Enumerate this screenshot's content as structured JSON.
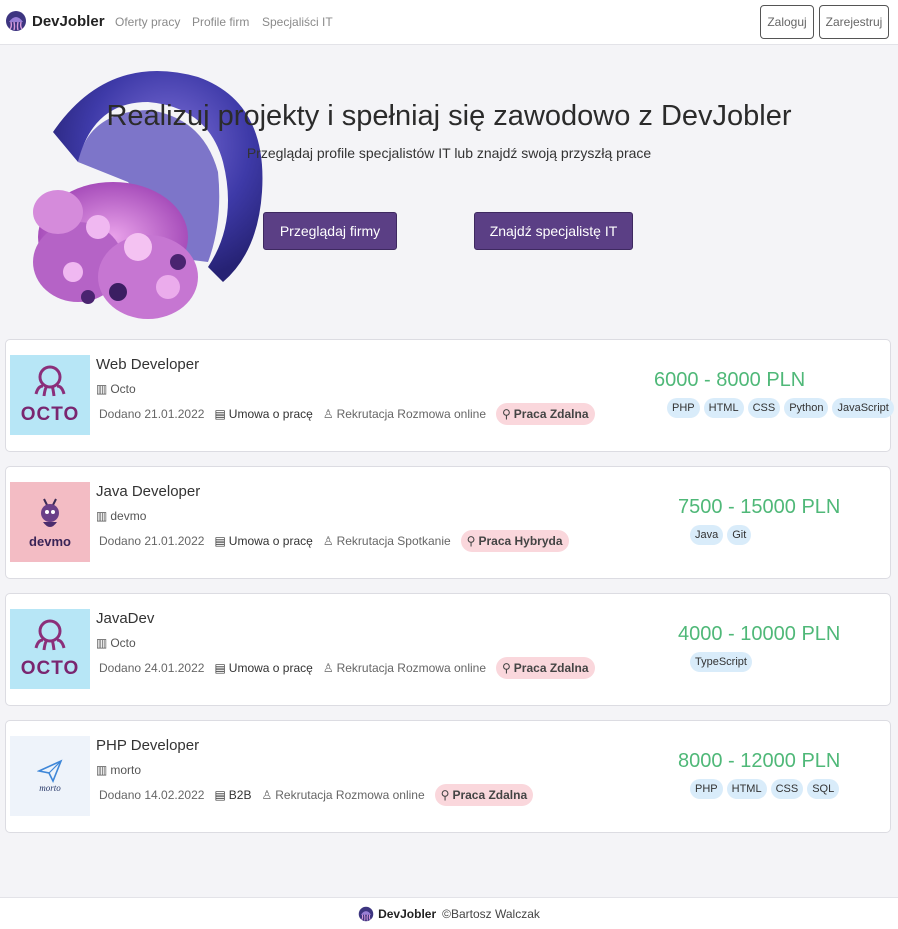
{
  "nav": {
    "brand": "DevJobler",
    "links": [
      "Oferty pracy",
      "Profile firm",
      "Specjaliści IT"
    ],
    "login": "Zaloguj",
    "register": "Zarejestruj"
  },
  "hero": {
    "title": "Realizuj projekty i spełniaj się zawodowo z DevJobler",
    "subtitle": "Przeglądaj profile specjalistów IT lub znajdź swoją przyszłą prace",
    "btn_companies": "Przeglądaj firmy",
    "btn_specialists": "Znajdź specjalistę IT"
  },
  "jobs": [
    {
      "title": "Web Developer",
      "company": "Octo",
      "logo_text": "OCTO",
      "added": "Dodano 21.01.2022",
      "contract": "Umowa o pracę",
      "recruitment": "Rekrutacja Rozmowa online",
      "work_mode": "Praca Zdalna",
      "salary": "6000 - 8000 PLN",
      "tags": [
        "PHP",
        "HTML",
        "CSS",
        "Python",
        "JavaScript"
      ]
    },
    {
      "title": "Java Developer",
      "company": "devmo",
      "logo_text": "devmo",
      "added": "Dodano 21.01.2022",
      "contract": "Umowa o pracę",
      "recruitment": "Rekrutacja Spotkanie",
      "work_mode": "Praca Hybryda",
      "salary": "7500 - 15000 PLN",
      "tags": [
        "Java",
        "Git"
      ]
    },
    {
      "title": "JavaDev",
      "company": "Octo",
      "logo_text": "OCTO",
      "added": "Dodano 24.01.2022",
      "contract": "Umowa o pracę",
      "recruitment": "Rekrutacja Rozmowa online",
      "work_mode": "Praca Zdalna",
      "salary": "4000 - 10000 PLN",
      "tags": [
        "TypeScript"
      ]
    },
    {
      "title": "PHP Developer",
      "company": "morto",
      "logo_text": "morto",
      "added": "Dodano 14.02.2022",
      "contract": "B2B",
      "recruitment": "Rekrutacja Rozmowa online",
      "work_mode": "Praca Zdalna",
      "salary": "8000 - 12000 PLN",
      "tags": [
        "PHP",
        "HTML",
        "CSS",
        "SQL"
      ]
    }
  ],
  "footer": {
    "brand": "DevJobler",
    "copyright": "©Bartosz Walczak"
  },
  "colors": {
    "primary": "#5b3f85",
    "salary": "#4fb878",
    "tag_bg": "#d9ecfa",
    "work_badge_bg": "#fad7dc"
  }
}
